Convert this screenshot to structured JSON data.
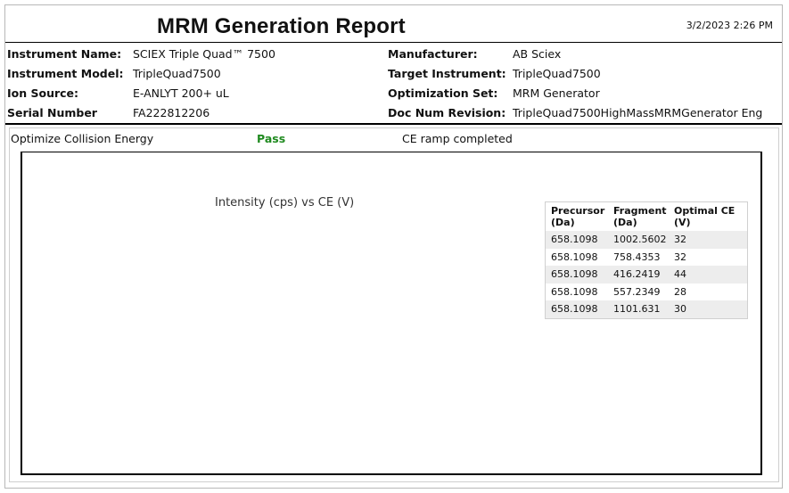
{
  "report": {
    "title": "MRM Generation Report",
    "datetime": "3/2/2023 2:26 PM"
  },
  "header": {
    "left": [
      {
        "label": "Instrument Name:",
        "value": "SCIEX Triple Quad™ 7500"
      },
      {
        "label": "Instrument Model:",
        "value": "TripleQuad7500"
      },
      {
        "label": "Ion Source:",
        "value": "E-ANLYT 200+ uL"
      },
      {
        "label": "Serial Number",
        "value": "FA222812206"
      }
    ],
    "right": [
      {
        "label": "Manufacturer:",
        "value": "AB Sciex"
      },
      {
        "label": "Target Instrument:",
        "value": "TripleQuad7500"
      },
      {
        "label": "Optimization Set:",
        "value": "MRM Generator"
      },
      {
        "label": "Doc Num Revision:",
        "value": "TripleQuad7500HighMassMRMGenerator Eng"
      }
    ]
  },
  "status": {
    "step": "Optimize Collision Energy",
    "result": "Pass",
    "message": "CE ramp completed"
  },
  "chart": {
    "title": "Intensity (cps) vs CE (V)"
  },
  "table": {
    "headers": [
      "Precursor (Da)",
      "Fragment (Da)",
      "Optimal CE (V)"
    ],
    "rows": [
      [
        "658.1098",
        "1002.5602",
        "32"
      ],
      [
        "658.1098",
        "758.4353",
        "32"
      ],
      [
        "658.1098",
        "416.2419",
        "44"
      ],
      [
        "658.1098",
        "557.2349",
        "28"
      ],
      [
        "658.1098",
        "1101.631",
        "30"
      ]
    ]
  }
}
